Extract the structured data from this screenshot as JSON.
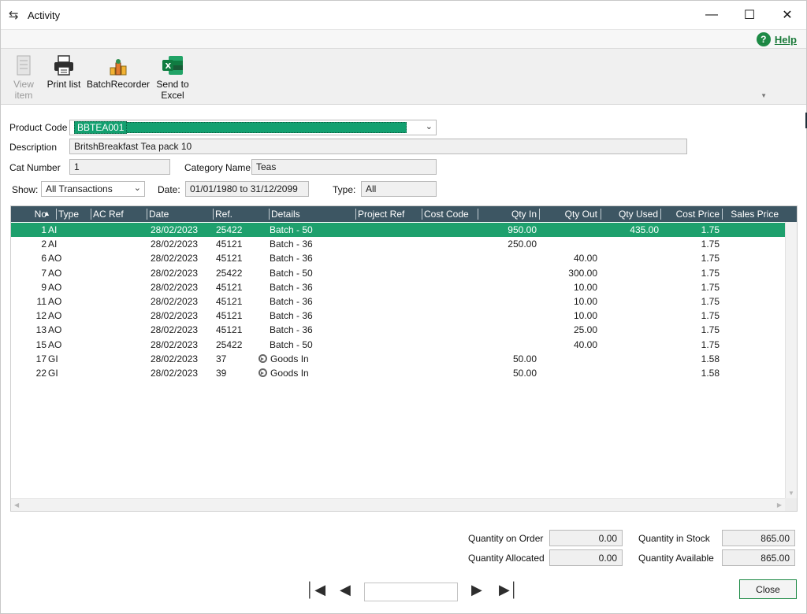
{
  "window": {
    "title": "Activity",
    "help_label": "Help"
  },
  "toolbar": {
    "view_item_label_1": "View",
    "view_item_label_2": "item",
    "print_list_label": "Print list",
    "batch_recorder_label": "BatchRecorder",
    "send_excel_label_1": "Send to",
    "send_excel_label_2": "Excel"
  },
  "form": {
    "product_code_label": "Product Code",
    "product_code_value": "BBTEA001",
    "description_label": "Description",
    "description_value": "BritshBreakfast  Tea pack 10",
    "cat_number_label": "Cat Number",
    "cat_number_value": "1",
    "category_name_label": "Category Name",
    "category_name_value": "Teas",
    "show_label": "Show:",
    "show_value": "All Transactions",
    "date_label": "Date:",
    "date_value": "01/01/1980 to 31/12/2099",
    "type_label": "Type:",
    "type_value": "All"
  },
  "grid": {
    "columns": [
      "No",
      "Type",
      "AC Ref",
      "Date",
      "Ref.",
      "Details",
      "Project Ref",
      "Cost Code",
      "Qty In",
      "Qty Out",
      "Qty Used",
      "Cost Price",
      "Sales Price"
    ],
    "rows": [
      {
        "no": "1",
        "type": "AI",
        "ac_ref": "",
        "date": "28/02/2023",
        "ref": "25422",
        "details": "Batch - 50",
        "goods_icon": false,
        "qty_in": "950.00",
        "qty_out": "",
        "qty_used": "435.00",
        "cost_price": "1.75",
        "sales_price": "",
        "selected": true
      },
      {
        "no": "2",
        "type": "AI",
        "ac_ref": "",
        "date": "28/02/2023",
        "ref": "45121",
        "details": "Batch - 36",
        "goods_icon": false,
        "qty_in": "250.00",
        "qty_out": "",
        "qty_used": "",
        "cost_price": "1.75",
        "sales_price": ""
      },
      {
        "no": "6",
        "type": "AO",
        "ac_ref": "",
        "date": "28/02/2023",
        "ref": "45121",
        "details": "Batch - 36",
        "goods_icon": false,
        "qty_in": "",
        "qty_out": "40.00",
        "qty_used": "",
        "cost_price": "1.75",
        "sales_price": ""
      },
      {
        "no": "7",
        "type": "AO",
        "ac_ref": "",
        "date": "28/02/2023",
        "ref": "25422",
        "details": "Batch - 50",
        "goods_icon": false,
        "qty_in": "",
        "qty_out": "300.00",
        "qty_used": "",
        "cost_price": "1.75",
        "sales_price": ""
      },
      {
        "no": "9",
        "type": "AO",
        "ac_ref": "",
        "date": "28/02/2023",
        "ref": "45121",
        "details": "Batch - 36",
        "goods_icon": false,
        "qty_in": "",
        "qty_out": "10.00",
        "qty_used": "",
        "cost_price": "1.75",
        "sales_price": ""
      },
      {
        "no": "11",
        "type": "AO",
        "ac_ref": "",
        "date": "28/02/2023",
        "ref": "45121",
        "details": "Batch - 36",
        "goods_icon": false,
        "qty_in": "",
        "qty_out": "10.00",
        "qty_used": "",
        "cost_price": "1.75",
        "sales_price": ""
      },
      {
        "no": "12",
        "type": "AO",
        "ac_ref": "",
        "date": "28/02/2023",
        "ref": "45121",
        "details": "Batch - 36",
        "goods_icon": false,
        "qty_in": "",
        "qty_out": "10.00",
        "qty_used": "",
        "cost_price": "1.75",
        "sales_price": ""
      },
      {
        "no": "13",
        "type": "AO",
        "ac_ref": "",
        "date": "28/02/2023",
        "ref": "45121",
        "details": "Batch - 36",
        "goods_icon": false,
        "qty_in": "",
        "qty_out": "25.00",
        "qty_used": "",
        "cost_price": "1.75",
        "sales_price": ""
      },
      {
        "no": "15",
        "type": "AO",
        "ac_ref": "",
        "date": "28/02/2023",
        "ref": "25422",
        "details": "Batch - 50",
        "goods_icon": false,
        "qty_in": "",
        "qty_out": "40.00",
        "qty_used": "",
        "cost_price": "1.75",
        "sales_price": ""
      },
      {
        "no": "17",
        "type": "GI",
        "ac_ref": "",
        "date": "28/02/2023",
        "ref": "37",
        "details": "Goods In",
        "goods_icon": true,
        "qty_in": "50.00",
        "qty_out": "",
        "qty_used": "",
        "cost_price": "1.58",
        "sales_price": ""
      },
      {
        "no": "22",
        "type": "GI",
        "ac_ref": "",
        "date": "28/02/2023",
        "ref": "39",
        "details": "Goods In",
        "goods_icon": true,
        "qty_in": "50.00",
        "qty_out": "",
        "qty_used": "",
        "cost_price": "1.58",
        "sales_price": ""
      }
    ]
  },
  "totals": {
    "qty_on_order_label": "Quantity on Order",
    "qty_on_order_value": "0.00",
    "qty_allocated_label": "Quantity Allocated",
    "qty_allocated_value": "0.00",
    "qty_in_stock_label": "Quantity in Stock",
    "qty_in_stock_value": "865.00",
    "qty_available_label": "Quantity Available",
    "qty_available_value": "865.00"
  },
  "footer": {
    "close_label": "Close",
    "record_value": ""
  },
  "colors": {
    "accent": "#1d8a45",
    "selected_row": "#1ea06d",
    "grid_header": "#3d5663"
  }
}
